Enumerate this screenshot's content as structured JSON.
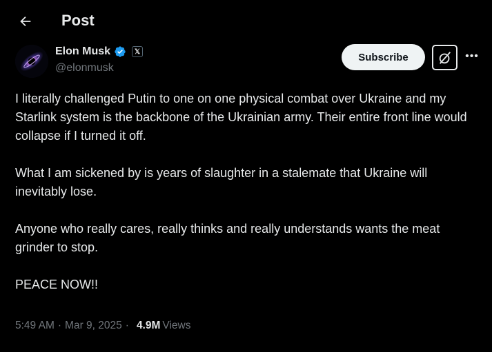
{
  "header": {
    "title": "Post",
    "back_icon": "arrow-left-icon"
  },
  "author": {
    "name": "Elon Musk",
    "handle": "@elonmusk",
    "verified_color": "#1d9bf0",
    "affiliate_badge": "𝕏"
  },
  "actions": {
    "subscribe_label": "Subscribe",
    "grok_icon": "grok-icon",
    "more_icon": "more-options-icon"
  },
  "post": {
    "paragraphs": [
      "I literally challenged Putin to one on one physical combat over Ukraine and my Starlink system is the backbone of the Ukrainian army. Their entire front line would collapse if I turned it off.",
      "What I am sickened by is years of slaughter in a stalemate that Ukraine will inevitably lose.",
      "Anyone who really cares, really thinks and really understands wants the meat grinder to stop.",
      "PEACE NOW!!"
    ]
  },
  "meta": {
    "time": "5:49 AM",
    "separator": "·",
    "date": "Mar 9, 2025",
    "views_count": "4.9M",
    "views_label": "Views"
  },
  "colors": {
    "background": "#000000",
    "text_primary": "#e7e9ea",
    "text_secondary": "#71767b",
    "button_bg": "#eff3f4"
  }
}
